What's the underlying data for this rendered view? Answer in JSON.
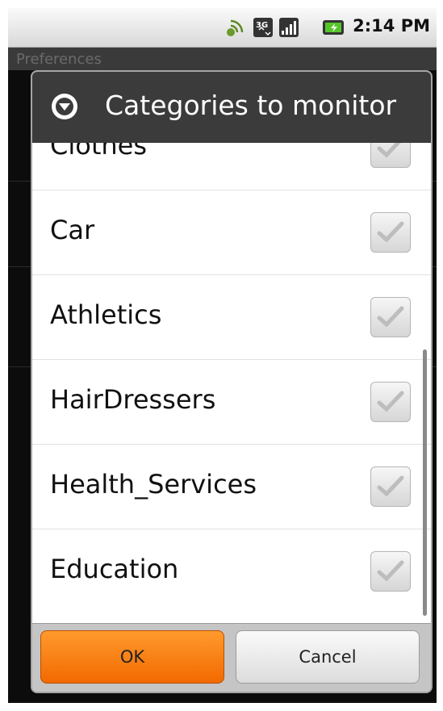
{
  "status_bar": {
    "time": "2:14 PM",
    "icons": [
      "signal-sync-icon",
      "3g-data-icon",
      "cell-signal-icon",
      "battery-charging-icon"
    ]
  },
  "background": {
    "title": "Preferences"
  },
  "dialog": {
    "title": "Categories to monitor",
    "header_icon": "chevron-down-circle-icon",
    "items": [
      {
        "label": "Clothes",
        "checked": true
      },
      {
        "label": "Car",
        "checked": true
      },
      {
        "label": "Athletics",
        "checked": true
      },
      {
        "label": "HairDressers",
        "checked": true
      },
      {
        "label": "Health_Services",
        "checked": true
      },
      {
        "label": "Education",
        "checked": true
      }
    ],
    "ok_label": "OK",
    "cancel_label": "Cancel"
  },
  "colors": {
    "accent": "#f27a10",
    "header": "#3b3b3b"
  }
}
